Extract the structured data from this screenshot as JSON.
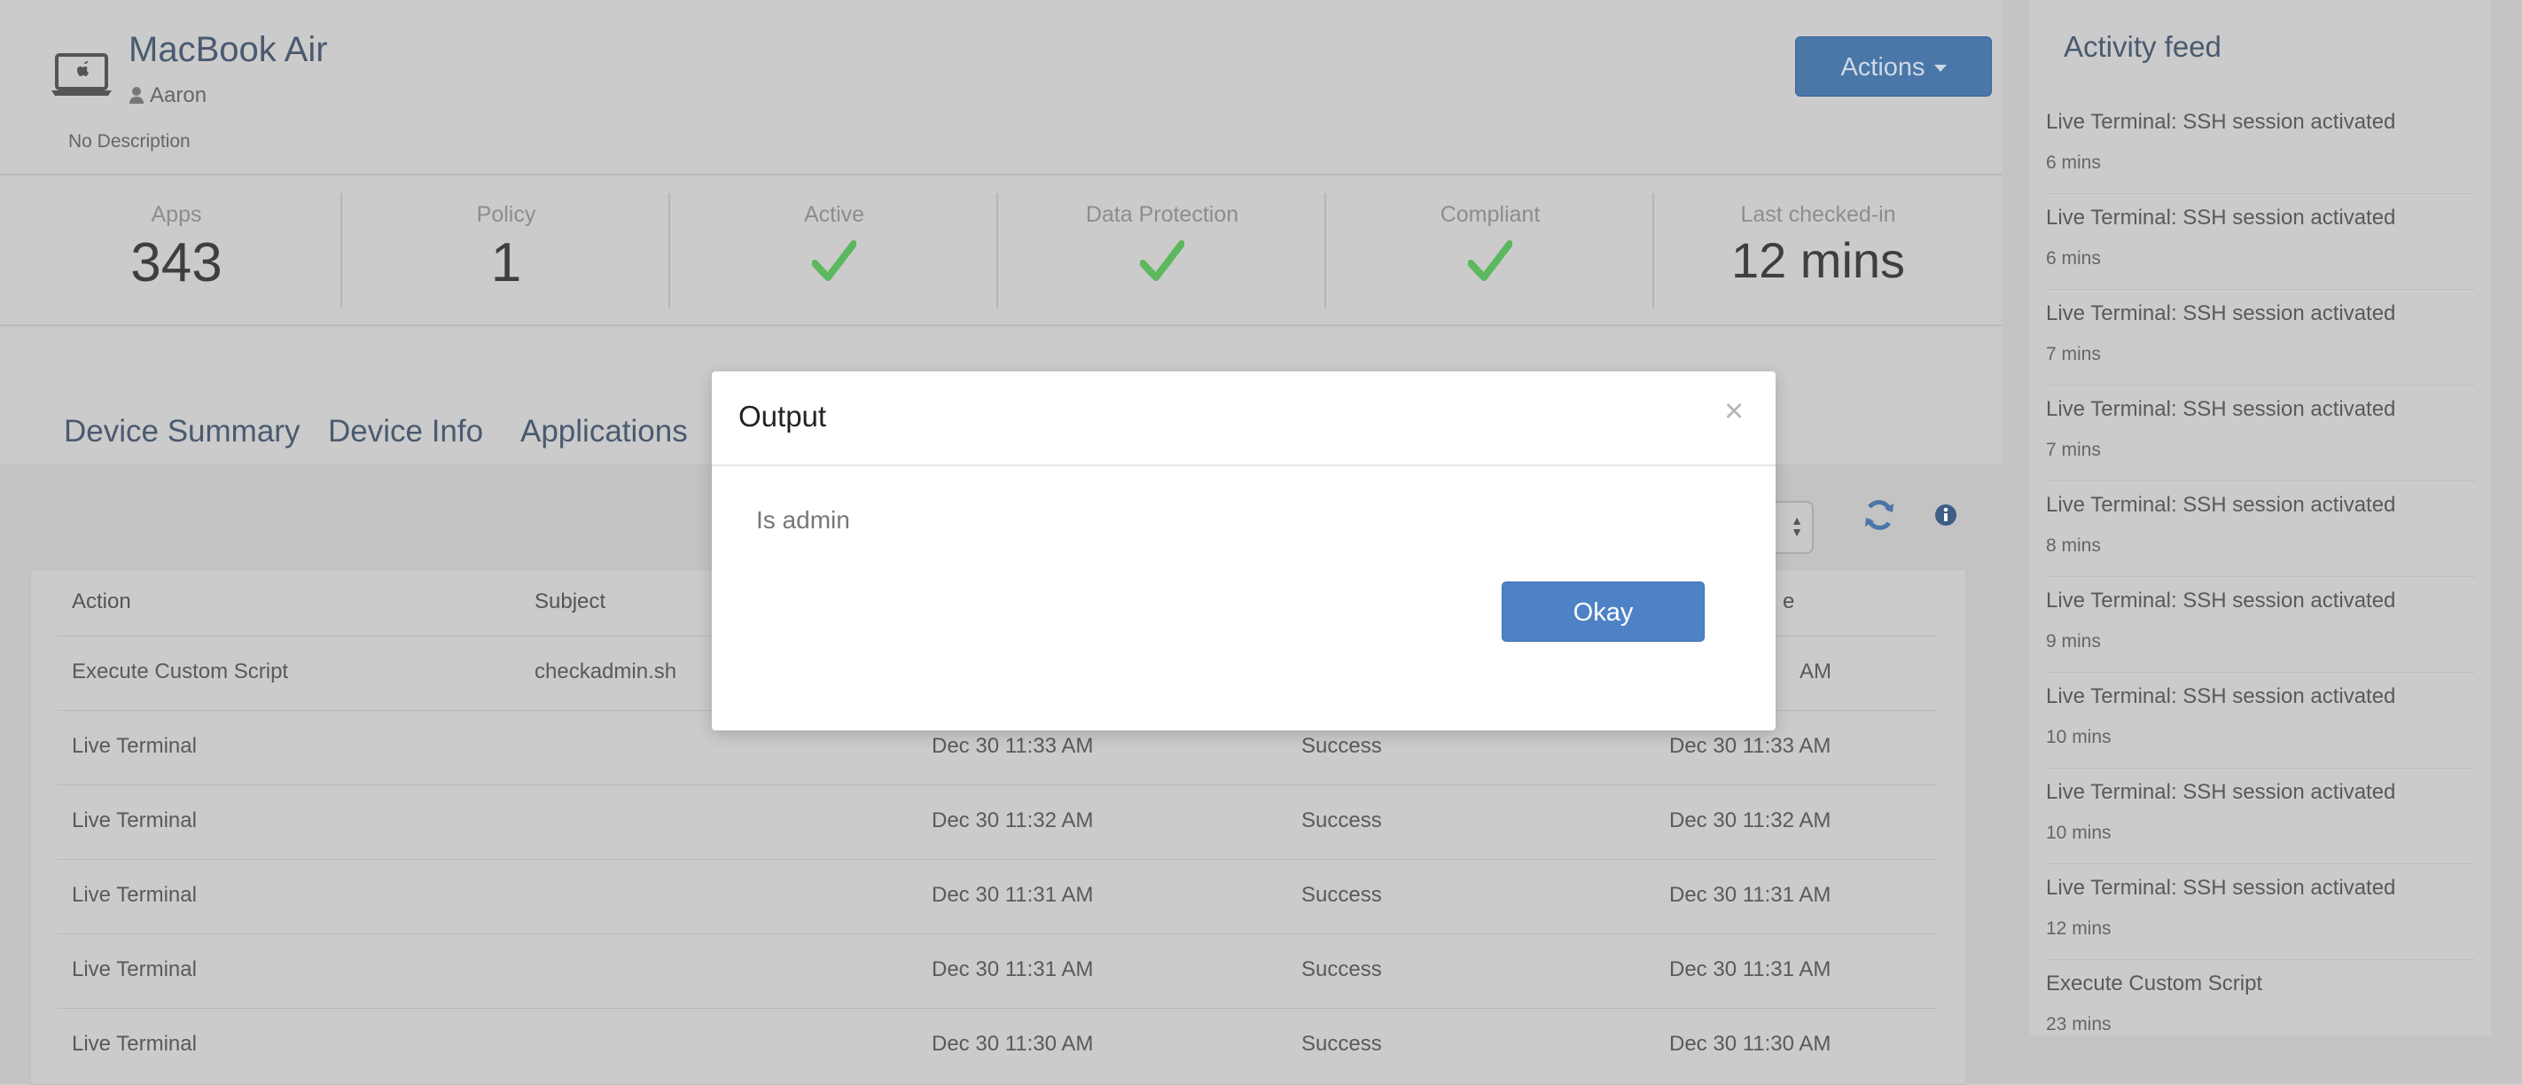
{
  "device": {
    "name": "MacBook Air",
    "owner": "Aaron",
    "description": "No Description",
    "actions_label": "Actions"
  },
  "stats": [
    {
      "label": "Apps",
      "value": "343"
    },
    {
      "label": "Policy",
      "value": "1"
    },
    {
      "label": "Active",
      "value": "check"
    },
    {
      "label": "Data Protection",
      "value": "check"
    },
    {
      "label": "Compliant",
      "value": "check"
    },
    {
      "label": "Last checked-in",
      "value": "12 mins"
    }
  ],
  "tabs": [
    "Device Summary",
    "Device Info",
    "Applications"
  ],
  "table": {
    "headers": [
      "Action",
      "Subject",
      "",
      "",
      "e"
    ],
    "rows": [
      {
        "action": "Execute Custom Script",
        "subject": "checkadmin.sh",
        "created": "",
        "status": "",
        "updated": "AM"
      },
      {
        "action": "Live Terminal",
        "subject": "",
        "created": "Dec 30 11:33 AM",
        "status": "Success",
        "updated": "Dec 30 11:33 AM"
      },
      {
        "action": "Live Terminal",
        "subject": "",
        "created": "Dec 30 11:32 AM",
        "status": "Success",
        "updated": "Dec 30 11:32 AM"
      },
      {
        "action": "Live Terminal",
        "subject": "",
        "created": "Dec 30 11:31 AM",
        "status": "Success",
        "updated": "Dec 30 11:31 AM"
      },
      {
        "action": "Live Terminal",
        "subject": "",
        "created": "Dec 30 11:31 AM",
        "status": "Success",
        "updated": "Dec 30 11:31 AM"
      },
      {
        "action": "Live Terminal",
        "subject": "",
        "created": "Dec 30 11:30 AM",
        "status": "Success",
        "updated": "Dec 30 11:30 AM"
      }
    ]
  },
  "feed": {
    "title": "Activity feed",
    "items": [
      {
        "text": "Live Terminal: SSH session activated",
        "time": "6 mins"
      },
      {
        "text": "Live Terminal: SSH session activated",
        "time": "6 mins"
      },
      {
        "text": "Live Terminal: SSH session activated",
        "time": "7 mins"
      },
      {
        "text": "Live Terminal: SSH session activated",
        "time": "7 mins"
      },
      {
        "text": "Live Terminal: SSH session activated",
        "time": "8 mins"
      },
      {
        "text": "Live Terminal: SSH session activated",
        "time": "9 mins"
      },
      {
        "text": "Live Terminal: SSH session activated",
        "time": "10 mins"
      },
      {
        "text": "Live Terminal: SSH session activated",
        "time": "10 mins"
      },
      {
        "text": "Live Terminal: SSH session activated",
        "time": "12 mins"
      },
      {
        "text": "Execute Custom Script",
        "time": "23 mins"
      }
    ]
  },
  "modal": {
    "title": "Output",
    "close_glyph": "×",
    "body": "Is admin",
    "okay_label": "Okay"
  },
  "icons": {
    "device": "laptop-apple-icon",
    "owner": "user-icon",
    "check": "checkmark-icon",
    "refresh": "refresh-icon",
    "info": "info-icon"
  },
  "colors": {
    "accent": "#4a76a8",
    "okay": "#4e82c6",
    "check": "#5cb85c",
    "heading": "#4a5a70"
  }
}
